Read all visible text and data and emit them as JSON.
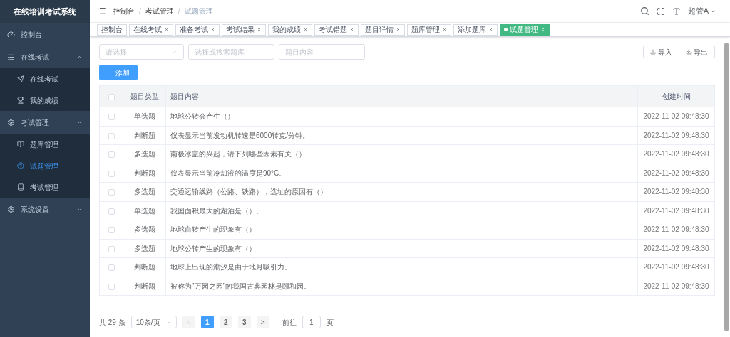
{
  "sidebar": {
    "title": "在线培训考试系统",
    "menu": [
      {
        "kind": "item",
        "label": "控制台"
      },
      {
        "kind": "group",
        "label": "在线考试",
        "expanded": true,
        "children": [
          {
            "label": "在线考试",
            "selected": false
          },
          {
            "label": "我的成绩",
            "selected": false
          }
        ]
      },
      {
        "kind": "group",
        "label": "考试管理",
        "expanded": true,
        "children": [
          {
            "label": "题库管理",
            "selected": false
          },
          {
            "label": "试题管理",
            "selected": true
          },
          {
            "label": "考试管理",
            "selected": false
          }
        ]
      },
      {
        "kind": "group",
        "label": "系统设置",
        "expanded": false
      }
    ]
  },
  "header": {
    "breadcrumb_separator": "/",
    "breadcrumb": [
      "控制台",
      "考试管理",
      "试题管理"
    ],
    "user": "超管A"
  },
  "tags": [
    {
      "label": "控制台",
      "closable": false,
      "selected": false
    },
    {
      "label": "在线考试",
      "closable": true,
      "selected": false
    },
    {
      "label": "准备考试",
      "closable": true,
      "selected": false
    },
    {
      "label": "考试结果",
      "closable": true,
      "selected": false
    },
    {
      "label": "我的成绩",
      "closable": true,
      "selected": false
    },
    {
      "label": "考试错题",
      "closable": true,
      "selected": false
    },
    {
      "label": "题目详情",
      "closable": true,
      "selected": false
    },
    {
      "label": "题库管理",
      "closable": true,
      "selected": false
    },
    {
      "label": "添加题库",
      "closable": true,
      "selected": false
    },
    {
      "label": "试题管理",
      "closable": true,
      "selected": true
    }
  ],
  "filters": {
    "type_select": {
      "placeholder": "请选择"
    },
    "bank_field": {
      "placeholder": "选择或搜索题库"
    },
    "content_field": {
      "placeholder": "题目内容"
    }
  },
  "actions": {
    "add": "添加",
    "import": "导入",
    "export": "导出"
  },
  "table": {
    "all_checked": false,
    "columns": [
      "题目类型",
      "题目内容",
      "创建时间"
    ],
    "rows": [
      {
        "checked": false,
        "type": "单选题",
        "content": "地球公转会产生（）",
        "time": "2022-11-02 09:48:30"
      },
      {
        "checked": false,
        "type": "判断题",
        "content": "仪表显示当前发动机转速是6000转克/分钟。",
        "time": "2022-11-02 09:48:30"
      },
      {
        "checked": false,
        "type": "多选题",
        "content": "南极冰盖的兴起，请下列哪些因素有关（）",
        "time": "2022-11-02 09:48:30"
      },
      {
        "checked": false,
        "type": "判断题",
        "content": "仪表显示当前冷却液的温度是90°C。",
        "time": "2022-11-02 09:48:30"
      },
      {
        "checked": false,
        "type": "多选题",
        "content": "交通运输线路（公路、铁路），选址的原因有（）",
        "time": "2022-11-02 09:48:30"
      },
      {
        "checked": false,
        "type": "单选题",
        "content": "我国面积最大的湖泊是（）。",
        "time": "2022-11-02 09:48:30"
      },
      {
        "checked": false,
        "type": "多选题",
        "content": "地球自转产生的现象有（）",
        "time": "2022-11-02 09:48:30"
      },
      {
        "checked": false,
        "type": "多选题",
        "content": "地球公转产生的现象有（）",
        "time": "2022-11-02 09:48:30"
      },
      {
        "checked": false,
        "type": "判断题",
        "content": "地球上出现的潮汐是由于地月吸引力。",
        "time": "2022-11-02 09:48:30"
      },
      {
        "checked": false,
        "type": "判断题",
        "content": "被称为\"万园之园\"的我国古典园林是颐和园。",
        "time": "2022-11-02 09:48:30"
      }
    ]
  },
  "pagination": {
    "total": "共 29 条",
    "page_size": "10条/页",
    "prev_disabled": true,
    "pages": [
      {
        "label": "1",
        "selected": true
      },
      {
        "label": "2",
        "selected": false
      },
      {
        "label": "3",
        "selected": false
      }
    ],
    "next": ">",
    "goto_label": "前往",
    "goto_value": "1",
    "goto_unit": "页"
  }
}
